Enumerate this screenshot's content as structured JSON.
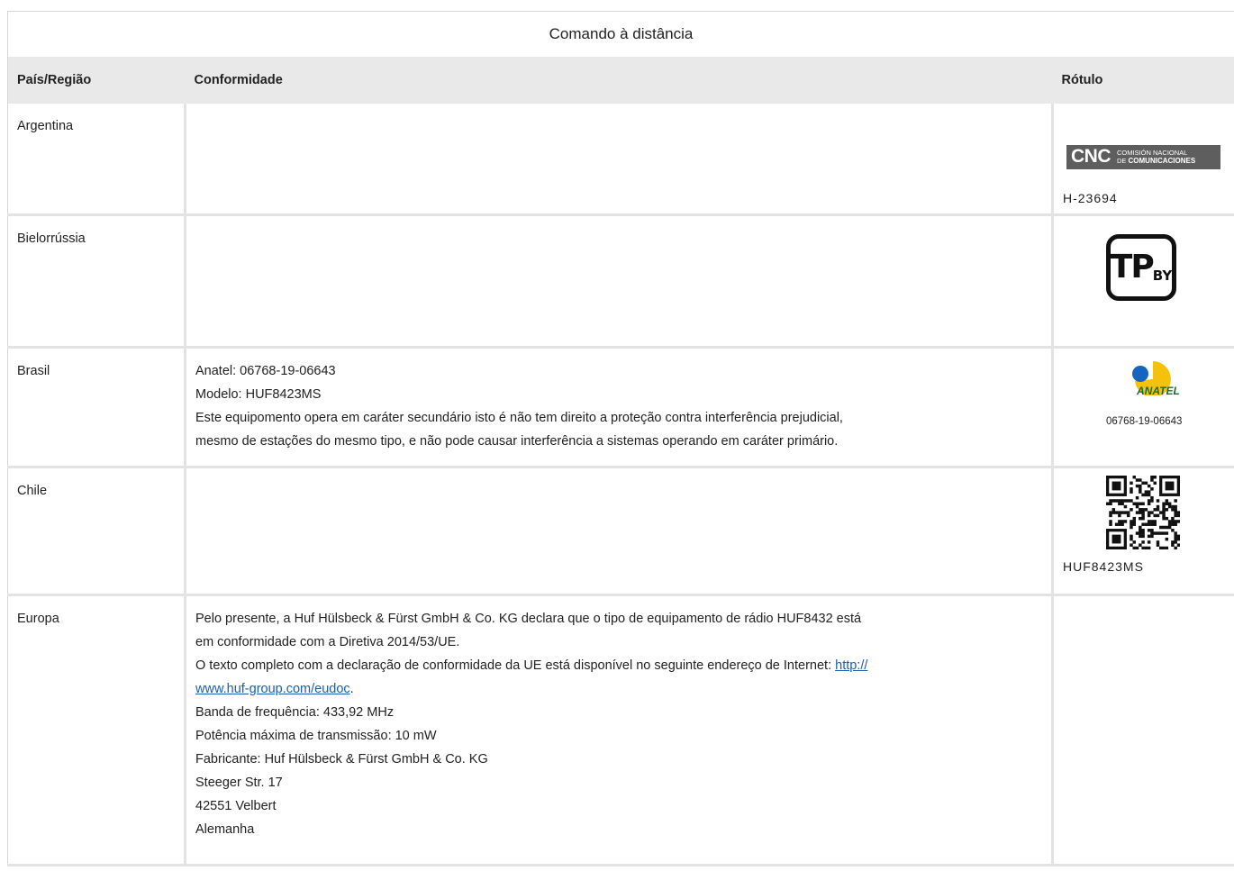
{
  "table": {
    "caption": "Comando à distância",
    "headers": {
      "country": "País/Região",
      "compliance": "Conformidade",
      "label": "Rótulo"
    }
  },
  "rows": {
    "argentina": {
      "country": "Argentina",
      "label_logo_mark": "CNC",
      "label_logo_text_top": "COMISIÓN NACIONAL",
      "label_logo_text_bottom_prefix": "DE ",
      "label_logo_text_bottom": "COMUNICACIONES",
      "label_code": "H-23694"
    },
    "belarus": {
      "country": "Bielorrússia",
      "label_logo_main": "TP",
      "label_logo_sub": "BY"
    },
    "brasil": {
      "country": "Brasil",
      "compliance": [
        "Anatel: 06768-19-06643",
        "Modelo: HUF8423MS",
        "Este equipomento opera em caráter secundário isto é não tem direito a proteção contra interferência prejudicial,",
        "mesmo de estações do mesmo tipo, e não pode causar interferência a sistemas operando em caráter primário."
      ],
      "label_logo_text": "ANATEL",
      "label_code": "06768-19-06643"
    },
    "chile": {
      "country": "Chile",
      "label_code": "HUF8423MS"
    },
    "europa": {
      "country": "Europa",
      "compliance": {
        "line1": "Pelo presente, a Huf Hülsbeck & Fürst GmbH & Co. KG declara que o tipo de equipamento de rádio HUF8432 está",
        "line2": "em conformidade com a Diretiva 2014/53/UE.",
        "line3": "O texto completo com a declaração de conformidade da UE está disponível no seguinte endereço de Internet: ",
        "link_part1": "http://",
        "link_part2": "www.huf-group.com/eudoc",
        "line4_suffix": ".",
        "line5": "Banda de frequência: 433,92 MHz",
        "line6": "Potência máxima de transmissão: 10 mW",
        "line7": "Fabricante: Huf Hülsbeck & Fürst GmbH & Co. KG",
        "line8": "Steeger Str. 17",
        "line9": "42551 Velbert",
        "line10": "Alemanha"
      }
    }
  },
  "colors": {
    "header_bg": "#e9e9e9",
    "border": "#e3e3e3",
    "link": "#1a5fb4",
    "cnc_bg": "#5e5e5e",
    "anatel_yellow": "#f4c20d",
    "anatel_blue": "#1565c0",
    "anatel_green": "#1f6b2e"
  }
}
